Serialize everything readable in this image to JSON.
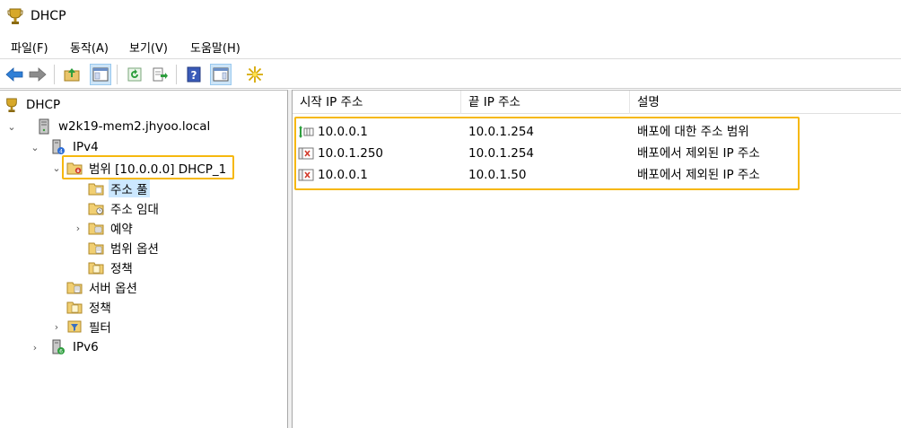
{
  "window": {
    "title": "DHCP",
    "app_icon": "trophy-dhcp-icon"
  },
  "menu": {
    "items": [
      "파일(F)",
      "동작(A)",
      "보기(V)",
      "도움말(H)"
    ]
  },
  "toolbar": {
    "buttons": [
      "back-arrow-icon",
      "forward-arrow-icon",
      "up-folder-icon",
      "show-hide-tree-icon",
      "refresh-icon",
      "export-list-icon",
      "help-icon",
      "action-pane-icon",
      "new-item-star-icon"
    ]
  },
  "tree": {
    "root": "DHCP",
    "server": "w2k19-mem2.jhyoo.local",
    "ipv4": "IPv4",
    "scope": "범위 [10.0.0.0] DHCP_1",
    "address_pool": "주소 풀",
    "address_leases": "주소 임대",
    "reservations": "예약",
    "scope_options": "범위 옵션",
    "scope_policies": "정책",
    "server_options": "서버 옵션",
    "server_policies": "정책",
    "filters": "필터",
    "ipv6": "IPv6"
  },
  "list": {
    "columns": [
      "시작 IP 주소",
      "끝 IP 주소",
      "설명"
    ],
    "rows": [
      {
        "start": "10.0.0.1",
        "end": "10.0.1.254",
        "desc": "배포에 대한 주소 범위",
        "icon": "address-range-icon"
      },
      {
        "start": "10.0.1.250",
        "end": "10.0.1.254",
        "desc": "배포에서 제외된 IP 주소",
        "icon": "excluded-range-icon"
      },
      {
        "start": "10.0.0.1",
        "end": "10.0.1.50",
        "desc": "배포에서 제외된 IP 주소",
        "icon": "excluded-range-icon"
      }
    ]
  },
  "colors": {
    "highlight": "#f6b80e",
    "selection": "#cce8ff"
  }
}
